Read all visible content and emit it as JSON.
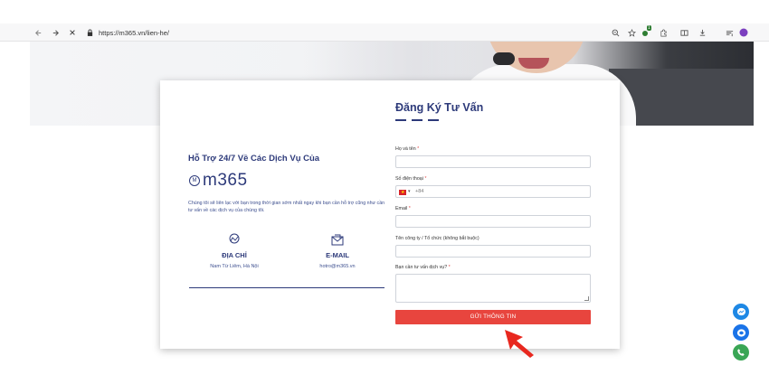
{
  "browser": {
    "url": "https://m365.vn/lien-he/",
    "icons": [
      "back-arrow-icon",
      "forward-arrow-icon",
      "close-icon",
      "lock-icon",
      "zoom-icon",
      "star-icon",
      "extension-icon",
      "puzzle-icon",
      "split-view-icon",
      "download-icon",
      "reading-list-icon",
      "profile-icon"
    ],
    "extension_badge": "1"
  },
  "support": {
    "title": "Hỗ Trợ 24/7 Về Các Dịch Vụ Của",
    "logo_mark": "M",
    "logo_text": "m365",
    "description": "Chúng tôi sẽ liên lạc với bạn trong thời gian sớm nhất ngay khi bạn cần hỗ trợ cũng như cần tư vấn về các dịch vụ của chúng tôi."
  },
  "contacts": [
    {
      "label": "ĐỊA CHỈ",
      "value": "Nam Từ Liêm, Hà Nội",
      "icon": "map-icon"
    },
    {
      "label": "E-MAIL",
      "value": "hotro@m365.vn",
      "icon": "mail-icon"
    }
  ],
  "form": {
    "title": "Đăng Ký Tư Vấn",
    "fields": {
      "name_label": "Họ và tên",
      "phone_label": "Số điện thoại",
      "phone_code": "+84",
      "email_label": "Email",
      "company_label": "Tên công ty / Tổ chức (không bắt buộc)",
      "service_label": "Bạn cần tư vấn dịch vụ?"
    },
    "required_mark": "*",
    "submit_label": "GỬI THÔNG TIN"
  },
  "colors": {
    "brand_navy": "#2d3a7a",
    "submit_red": "#e8453e",
    "arrow_red": "#e8281f",
    "messenger_blue": "#1e88e5",
    "zalo_blue": "#1a73e8",
    "phone_green": "#3aa655"
  },
  "floating": [
    "messenger-icon",
    "zalo-chat-icon",
    "phone-call-icon"
  ]
}
